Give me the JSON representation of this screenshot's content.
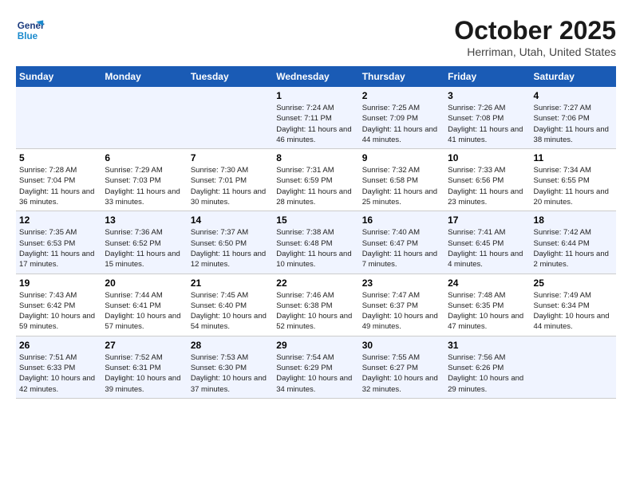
{
  "logo": {
    "line1": "General",
    "line2": "Blue"
  },
  "title": "October 2025",
  "location": "Herriman, Utah, United States",
  "header_days": [
    "Sunday",
    "Monday",
    "Tuesday",
    "Wednesday",
    "Thursday",
    "Friday",
    "Saturday"
  ],
  "weeks": [
    [
      {
        "num": "",
        "info": ""
      },
      {
        "num": "",
        "info": ""
      },
      {
        "num": "",
        "info": ""
      },
      {
        "num": "1",
        "info": "Sunrise: 7:24 AM\nSunset: 7:11 PM\nDaylight: 11 hours\nand 46 minutes."
      },
      {
        "num": "2",
        "info": "Sunrise: 7:25 AM\nSunset: 7:09 PM\nDaylight: 11 hours\nand 44 minutes."
      },
      {
        "num": "3",
        "info": "Sunrise: 7:26 AM\nSunset: 7:08 PM\nDaylight: 11 hours\nand 41 minutes."
      },
      {
        "num": "4",
        "info": "Sunrise: 7:27 AM\nSunset: 7:06 PM\nDaylight: 11 hours\nand 38 minutes."
      }
    ],
    [
      {
        "num": "5",
        "info": "Sunrise: 7:28 AM\nSunset: 7:04 PM\nDaylight: 11 hours\nand 36 minutes."
      },
      {
        "num": "6",
        "info": "Sunrise: 7:29 AM\nSunset: 7:03 PM\nDaylight: 11 hours\nand 33 minutes."
      },
      {
        "num": "7",
        "info": "Sunrise: 7:30 AM\nSunset: 7:01 PM\nDaylight: 11 hours\nand 30 minutes."
      },
      {
        "num": "8",
        "info": "Sunrise: 7:31 AM\nSunset: 6:59 PM\nDaylight: 11 hours\nand 28 minutes."
      },
      {
        "num": "9",
        "info": "Sunrise: 7:32 AM\nSunset: 6:58 PM\nDaylight: 11 hours\nand 25 minutes."
      },
      {
        "num": "10",
        "info": "Sunrise: 7:33 AM\nSunset: 6:56 PM\nDaylight: 11 hours\nand 23 minutes."
      },
      {
        "num": "11",
        "info": "Sunrise: 7:34 AM\nSunset: 6:55 PM\nDaylight: 11 hours\nand 20 minutes."
      }
    ],
    [
      {
        "num": "12",
        "info": "Sunrise: 7:35 AM\nSunset: 6:53 PM\nDaylight: 11 hours\nand 17 minutes."
      },
      {
        "num": "13",
        "info": "Sunrise: 7:36 AM\nSunset: 6:52 PM\nDaylight: 11 hours\nand 15 minutes."
      },
      {
        "num": "14",
        "info": "Sunrise: 7:37 AM\nSunset: 6:50 PM\nDaylight: 11 hours\nand 12 minutes."
      },
      {
        "num": "15",
        "info": "Sunrise: 7:38 AM\nSunset: 6:48 PM\nDaylight: 11 hours\nand 10 minutes."
      },
      {
        "num": "16",
        "info": "Sunrise: 7:40 AM\nSunset: 6:47 PM\nDaylight: 11 hours\nand 7 minutes."
      },
      {
        "num": "17",
        "info": "Sunrise: 7:41 AM\nSunset: 6:45 PM\nDaylight: 11 hours\nand 4 minutes."
      },
      {
        "num": "18",
        "info": "Sunrise: 7:42 AM\nSunset: 6:44 PM\nDaylight: 11 hours\nand 2 minutes."
      }
    ],
    [
      {
        "num": "19",
        "info": "Sunrise: 7:43 AM\nSunset: 6:42 PM\nDaylight: 10 hours\nand 59 minutes."
      },
      {
        "num": "20",
        "info": "Sunrise: 7:44 AM\nSunset: 6:41 PM\nDaylight: 10 hours\nand 57 minutes."
      },
      {
        "num": "21",
        "info": "Sunrise: 7:45 AM\nSunset: 6:40 PM\nDaylight: 10 hours\nand 54 minutes."
      },
      {
        "num": "22",
        "info": "Sunrise: 7:46 AM\nSunset: 6:38 PM\nDaylight: 10 hours\nand 52 minutes."
      },
      {
        "num": "23",
        "info": "Sunrise: 7:47 AM\nSunset: 6:37 PM\nDaylight: 10 hours\nand 49 minutes."
      },
      {
        "num": "24",
        "info": "Sunrise: 7:48 AM\nSunset: 6:35 PM\nDaylight: 10 hours\nand 47 minutes."
      },
      {
        "num": "25",
        "info": "Sunrise: 7:49 AM\nSunset: 6:34 PM\nDaylight: 10 hours\nand 44 minutes."
      }
    ],
    [
      {
        "num": "26",
        "info": "Sunrise: 7:51 AM\nSunset: 6:33 PM\nDaylight: 10 hours\nand 42 minutes."
      },
      {
        "num": "27",
        "info": "Sunrise: 7:52 AM\nSunset: 6:31 PM\nDaylight: 10 hours\nand 39 minutes."
      },
      {
        "num": "28",
        "info": "Sunrise: 7:53 AM\nSunset: 6:30 PM\nDaylight: 10 hours\nand 37 minutes."
      },
      {
        "num": "29",
        "info": "Sunrise: 7:54 AM\nSunset: 6:29 PM\nDaylight: 10 hours\nand 34 minutes."
      },
      {
        "num": "30",
        "info": "Sunrise: 7:55 AM\nSunset: 6:27 PM\nDaylight: 10 hours\nand 32 minutes."
      },
      {
        "num": "31",
        "info": "Sunrise: 7:56 AM\nSunset: 6:26 PM\nDaylight: 10 hours\nand 29 minutes."
      },
      {
        "num": "",
        "info": ""
      }
    ]
  ]
}
